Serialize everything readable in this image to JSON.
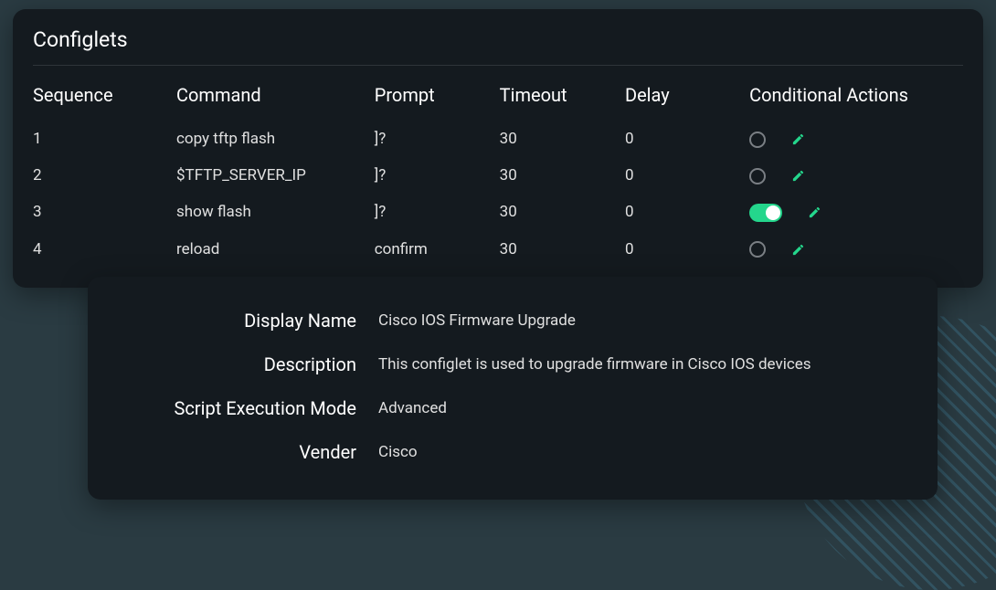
{
  "panel": {
    "title": "Configlets",
    "columns": {
      "sequence": "Sequence",
      "command": "Command",
      "prompt": "Prompt",
      "timeout": "Timeout",
      "delay": "Delay",
      "actions": "Conditional Actions"
    },
    "rows": [
      {
        "sequence": "1",
        "command": "copy tftp flash",
        "prompt": "]?",
        "timeout": "30",
        "delay": "0",
        "toggle": false
      },
      {
        "sequence": "2",
        "command": "$TFTP_SERVER_IP",
        "prompt": "]?",
        "timeout": "30",
        "delay": "0",
        "toggle": false
      },
      {
        "sequence": "3",
        "command": "show flash",
        "prompt": "]?",
        "timeout": "30",
        "delay": "0",
        "toggle": true
      },
      {
        "sequence": "4",
        "command": "reload",
        "prompt": "confirm",
        "timeout": "30",
        "delay": "0",
        "toggle": false
      }
    ]
  },
  "details": {
    "display_name": {
      "label": "Display Name",
      "value": "Cisco IOS Firmware Upgrade"
    },
    "description": {
      "label": "Description",
      "value": "This configlet is used to upgrade firmware in Cisco IOS devices"
    },
    "mode": {
      "label": "Script Execution Mode",
      "value": "Advanced"
    },
    "vendor": {
      "label": "Vender",
      "value": "Cisco"
    }
  }
}
